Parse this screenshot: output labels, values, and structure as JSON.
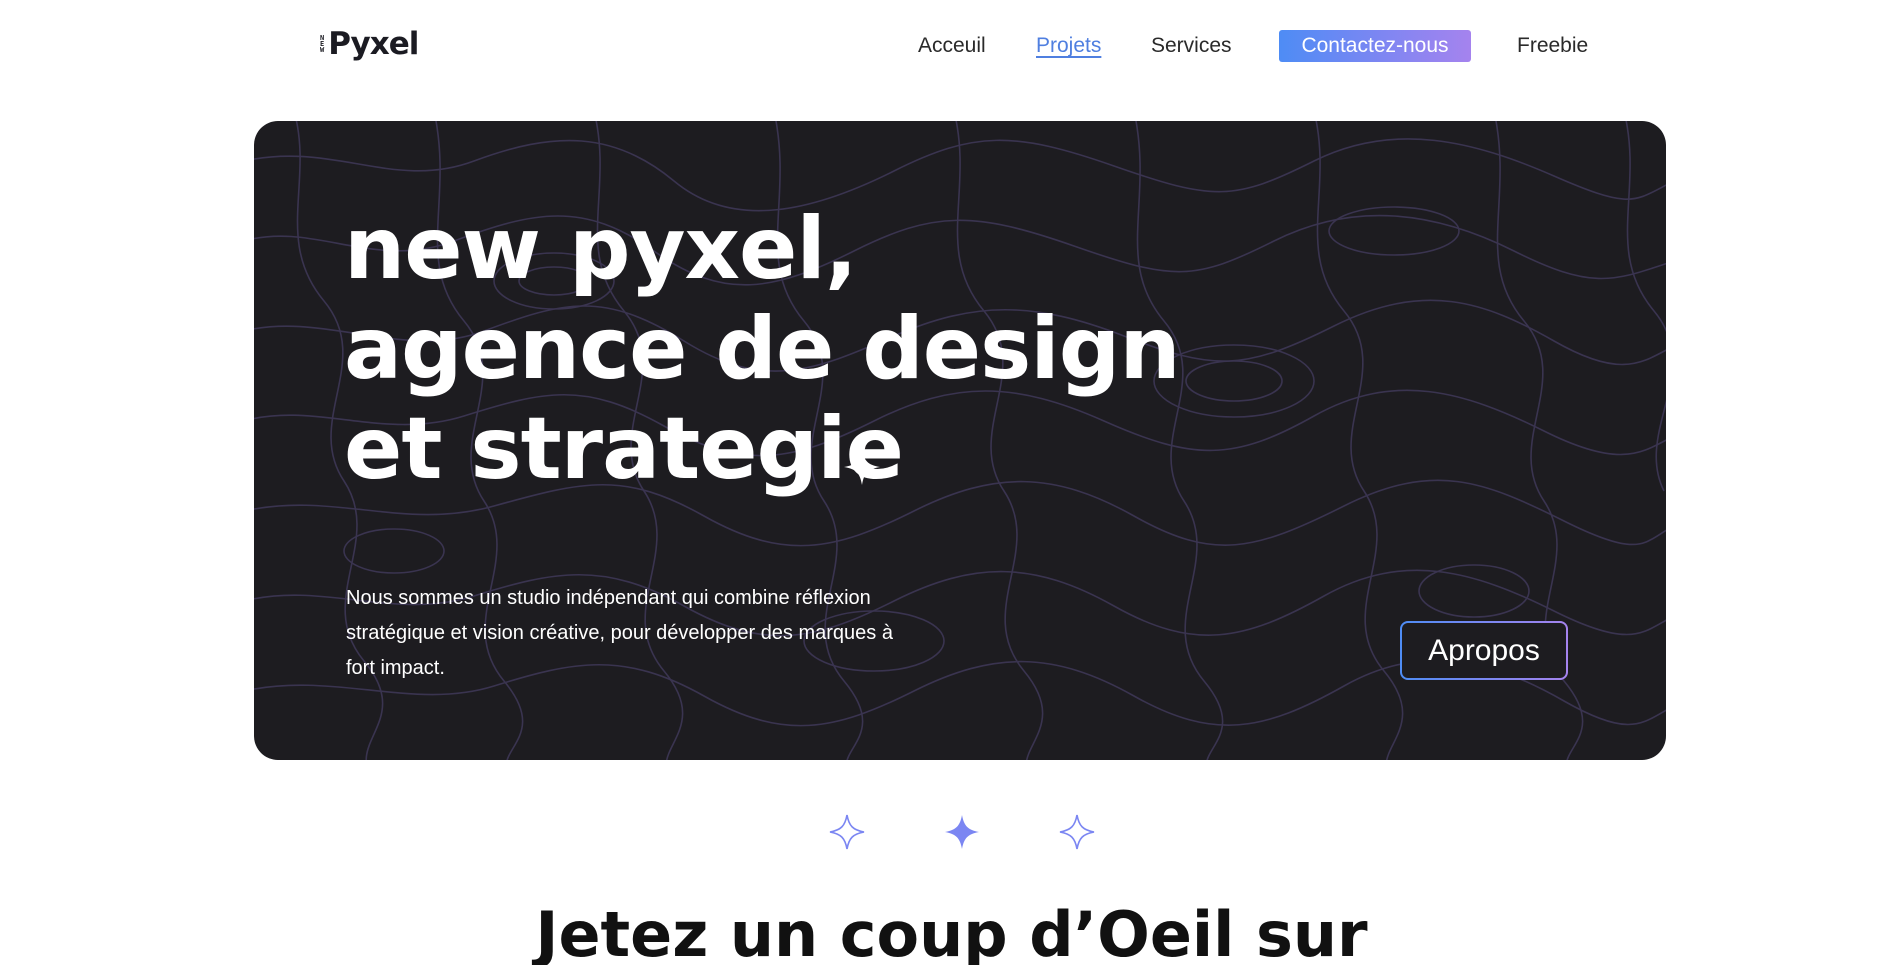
{
  "brand": {
    "logo_mark": [
      "N",
      "E",
      "W"
    ],
    "logo_word": "Pyxel"
  },
  "nav": {
    "items": [
      {
        "label": "Acceuil"
      },
      {
        "label": "Projets"
      },
      {
        "label": "Services"
      },
      {
        "label": "Contactez-nous"
      },
      {
        "label": "Freebie"
      }
    ],
    "active": "Projets"
  },
  "hero": {
    "title_lines": [
      "new pyxel,",
      "agence de design",
      "et strategie"
    ],
    "description": "Nous sommes un studio indépendant qui combine réflexion stratégique et vision créative, pour développer des marques à fort impact.",
    "cta_label": "Apropos"
  },
  "carousel": {
    "count": 3,
    "active_index": 1
  },
  "section": {
    "title": "Jetez un coup d’Oeil sur"
  },
  "colors": {
    "accent_blue": "#4e8cf5",
    "accent_purple": "#a583ee",
    "hero_bg": "#1d1c20",
    "pattern_line": "#3a3450"
  },
  "icons": {
    "hero_star": "sparkle-icon",
    "carousel_dot": "four-point-star-icon"
  }
}
